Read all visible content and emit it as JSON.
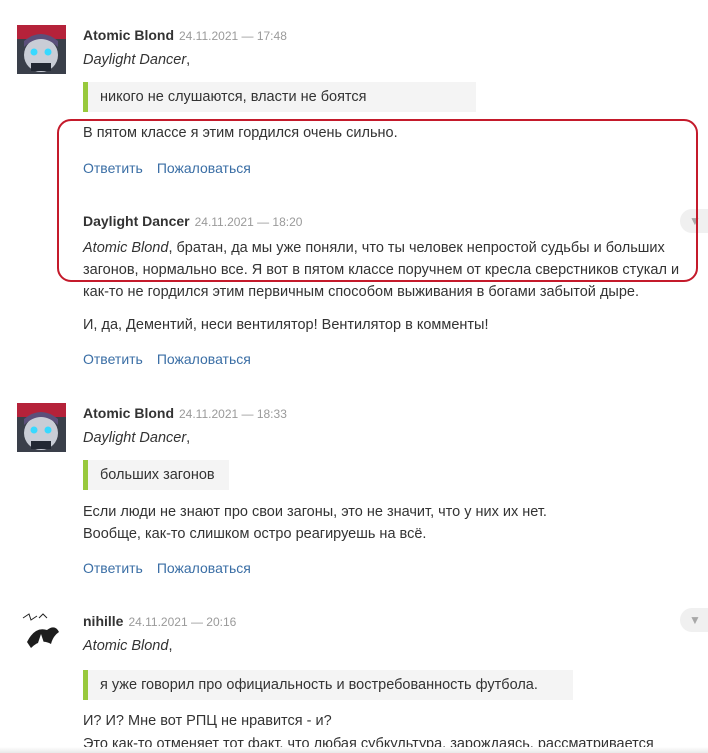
{
  "comments": [
    {
      "author": "Atomic Blond",
      "date": "24.11.2021 — 17:48",
      "addressee": "Daylight Dancer",
      "comma": ",",
      "quote": "никого не слушаются, власти не боятся",
      "lines": [
        "В пятом классе я этим гордился очень сильно."
      ],
      "reply": "Ответить",
      "report": "Пожаловаться"
    },
    {
      "author": "Daylight Dancer",
      "date": "24.11.2021 — 18:20",
      "addressee": "Atomic Blond",
      "first_line_rest": ", братан, да мы уже поняли, что ты человек непростой судьбы и больших",
      "lines": [
        "загонов, нормально все. Я вот в пятом классе поручнем от кресла сверстников стукал и",
        "как-то не гордился этим первичным способом выживания в богами забытой дыре.",
        "И, да, Дементий, неси вентилятор! Вентилятор в комменты!"
      ],
      "reply": "Ответить",
      "report": "Пожаловаться",
      "collapse_icon": "▼"
    },
    {
      "author": "Atomic Blond",
      "date": "24.11.2021 — 18:33",
      "addressee": "Daylight Dancer",
      "comma": ",",
      "quote": "больших загонов",
      "lines": [
        "Если люди не знают про свои загоны, это не значит, что у них их нет.",
        "Вообще, как-то слишком остро реагируешь на всё."
      ],
      "reply": "Ответить",
      "report": "Пожаловаться"
    },
    {
      "author": "nihille",
      "date": "24.11.2021 — 20:16",
      "addressee": "Atomic Blond",
      "comma": ",",
      "quote": "я уже говорил про официальность и востребованность футбола.",
      "lines": [
        "И? И? Мне вот РПЦ не нравится - и?",
        "Это как-то отменяет тот факт, что любая субкультура, зарождаясь, рассматривается"
      ],
      "collapse_icon": "▼"
    }
  ],
  "colors": {
    "link": "#3a6ea5",
    "quote_bar": "#98c93c",
    "highlight": "#c41a2b"
  }
}
